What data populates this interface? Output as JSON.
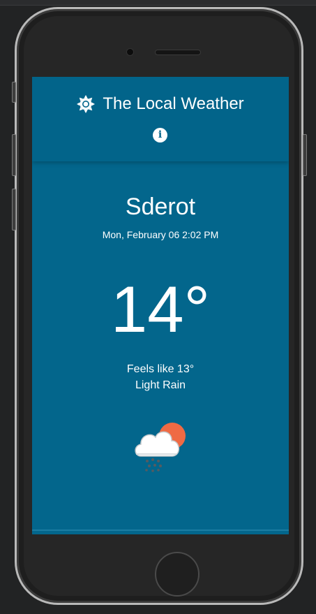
{
  "app": {
    "title": "The Local Weather",
    "info_icon": "info-icon",
    "logo_icon": "sun-gear-icon"
  },
  "weather": {
    "city": "Sderot",
    "datetime": "Mon, February 06 2:02 PM",
    "temperature": "14°",
    "feels_like": "Feels like 13°",
    "condition": "Light Rain",
    "condition_icon": "cloud-sun-rain-icon"
  },
  "colors": {
    "screen_background": "#03668c",
    "sun": "#ef6a44",
    "cloud": "#ecf0f1"
  }
}
